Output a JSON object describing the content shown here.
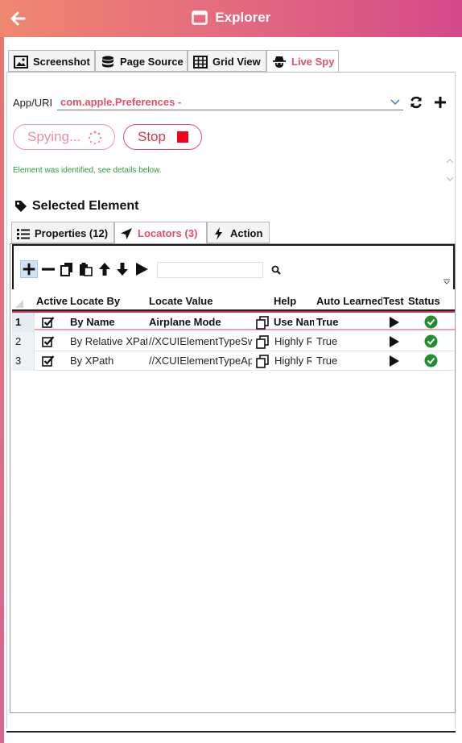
{
  "window": {
    "title": "Explorer"
  },
  "main_tabs": [
    {
      "label": "Screenshot",
      "icon": "image-icon"
    },
    {
      "label": "Page Source",
      "icon": "database-icon"
    },
    {
      "label": "Grid View",
      "icon": "grid-icon"
    },
    {
      "label": "Live Spy",
      "icon": "spy-icon",
      "active": true
    }
  ],
  "app": {
    "label": "App/URI",
    "value": "com.apple.Preferences -"
  },
  "spy": {
    "spying_label": "Spying...",
    "stop_label": "Stop"
  },
  "status_message": "Element was identified, see details below.",
  "selected_element": {
    "title": "Selected Element"
  },
  "sub_tabs": [
    {
      "label": "Properties (12)",
      "icon": "list-icon"
    },
    {
      "label": "Locators (3)",
      "icon": "location-arrow-icon",
      "active": true
    },
    {
      "label": "Action",
      "icon": "lightning-icon"
    }
  ],
  "grid": {
    "columns": [
      "Active",
      "Locate By",
      "Locate Value",
      "Help",
      "Auto Learned",
      "Test",
      "Status"
    ],
    "rows": [
      {
        "num": "1",
        "locate_by": "By Name",
        "locate_value": "Airplane Mode",
        "help": "Use Name",
        "auto_learned": "True",
        "selected": true
      },
      {
        "num": "2",
        "locate_by": "By Relative XPath",
        "locate_value": "//XCUIElementTypeSwitch",
        "help": "Highly Recommended",
        "auto_learned": "True"
      },
      {
        "num": "3",
        "locate_by": "By XPath",
        "locate_value": "//XCUIElementTypeApplication",
        "help": "Highly Recommended",
        "auto_learned": "True"
      }
    ]
  },
  "colors": {
    "accent": "#e0506a",
    "title_gradient_start": "#f08770",
    "title_gradient_end": "#d44a8a",
    "success": "#1e8e2e",
    "stop": "#f0001a"
  }
}
